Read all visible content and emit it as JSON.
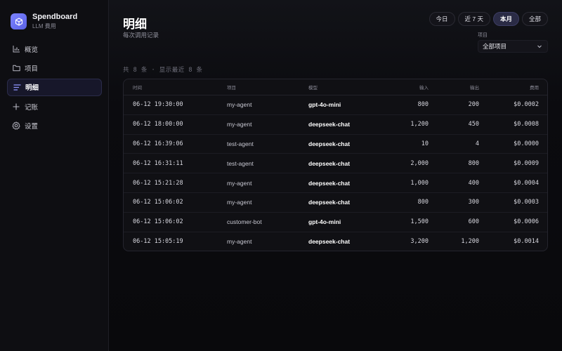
{
  "brand": {
    "name": "Spendboard",
    "subtitle": "LLM 費用",
    "logo_icon": "cube-icon",
    "accent": "#6c72f5"
  },
  "nav": [
    {
      "label": "概览",
      "icon": "bar-chart-icon",
      "active": false
    },
    {
      "label": "项目",
      "icon": "folder-icon",
      "active": false
    },
    {
      "label": "明细",
      "icon": "list-icon",
      "active": true
    },
    {
      "label": "记账",
      "icon": "plus-icon",
      "active": false
    },
    {
      "label": "设置",
      "icon": "gear-icon",
      "active": false
    }
  ],
  "page": {
    "title": "明细",
    "subtitle": "每次调用记录"
  },
  "range_tabs": [
    {
      "label": "今日",
      "active": false
    },
    {
      "label": "近 7 天",
      "active": false
    },
    {
      "label": "本月",
      "active": true
    },
    {
      "label": "全部",
      "active": false
    }
  ],
  "project_filter": {
    "label": "项目",
    "value": "全部项目"
  },
  "count_line": "共 8 条 · 显示最近 8 条",
  "table": {
    "headers": {
      "time": "时间",
      "project": "项目",
      "model": "模型",
      "input": "输入",
      "output": "输出",
      "cost": "费用"
    },
    "rows": [
      {
        "time": "06-12 19:30:00",
        "project": "my-agent",
        "model": "gpt-4o-mini",
        "input": "800",
        "output": "200",
        "cost": "$0.0002"
      },
      {
        "time": "06-12 18:00:00",
        "project": "my-agent",
        "model": "deepseek-chat",
        "input": "1,200",
        "output": "450",
        "cost": "$0.0008"
      },
      {
        "time": "06-12 16:39:06",
        "project": "test-agent",
        "model": "deepseek-chat",
        "input": "10",
        "output": "4",
        "cost": "$0.0000"
      },
      {
        "time": "06-12 16:31:11",
        "project": "test-agent",
        "model": "deepseek-chat",
        "input": "2,000",
        "output": "800",
        "cost": "$0.0009"
      },
      {
        "time": "06-12 15:21:28",
        "project": "my-agent",
        "model": "deepseek-chat",
        "input": "1,000",
        "output": "400",
        "cost": "$0.0004"
      },
      {
        "time": "06-12 15:06:02",
        "project": "my-agent",
        "model": "deepseek-chat",
        "input": "800",
        "output": "300",
        "cost": "$0.0003"
      },
      {
        "time": "06-12 15:06:02",
        "project": "customer-bot",
        "model": "gpt-4o-mini",
        "input": "1,500",
        "output": "600",
        "cost": "$0.0006"
      },
      {
        "time": "06-12 15:05:19",
        "project": "my-agent",
        "model": "deepseek-chat",
        "input": "3,200",
        "output": "1,200",
        "cost": "$0.0014"
      }
    ]
  }
}
